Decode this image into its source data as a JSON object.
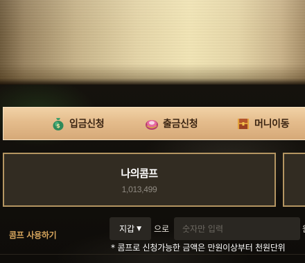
{
  "nav": {
    "items": [
      {
        "label": "입금신청",
        "icon": "money-bag-icon"
      },
      {
        "label": "출금신청",
        "icon": "gem-icon"
      },
      {
        "label": "머니이동",
        "icon": "treasure-chest-icon"
      }
    ]
  },
  "comp_panel": {
    "title": "나의콤프",
    "value": "1,013,499"
  },
  "comp_use": {
    "label": "콤프 사용하기",
    "select_value": "지갑",
    "connector": "으로",
    "amount_placeholder": "숫자만 입력",
    "unit_partial": "원",
    "note": "* 콤프로 신청가능한 금액은 만원이상부터 천원단위"
  },
  "colors": {
    "accent_gold": "#b59662",
    "label_orange": "#d6a55d",
    "panel_bg": "#322c22",
    "nav_bg": "#e4bc8c"
  }
}
